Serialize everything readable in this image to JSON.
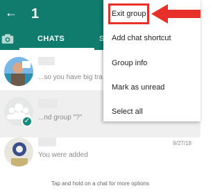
{
  "header": {
    "selected_count": "1",
    "tabs": [
      {
        "label": "CHATS"
      },
      {
        "label": "S"
      }
    ]
  },
  "chats": [
    {
      "snippet": "...so you have big tra",
      "time": ""
    },
    {
      "snippet": "...nd group \"?\"",
      "time": ""
    },
    {
      "snippet": "You were added",
      "time": "9/27/18"
    }
  ],
  "hint": "Tap and hold on a chat for more options",
  "menu": {
    "items": [
      {
        "label": "Exit group"
      },
      {
        "label": "Add chat shortcut"
      },
      {
        "label": "Group info"
      },
      {
        "label": "Mark as unread"
      },
      {
        "label": "Select all"
      }
    ]
  },
  "colors": {
    "header_bg": "#0f7c6e",
    "highlight": "#e8302a",
    "check": "#128c7e"
  },
  "icons": {
    "back": "arrow-left-icon",
    "camera": "camera-icon",
    "check": "check-icon"
  }
}
